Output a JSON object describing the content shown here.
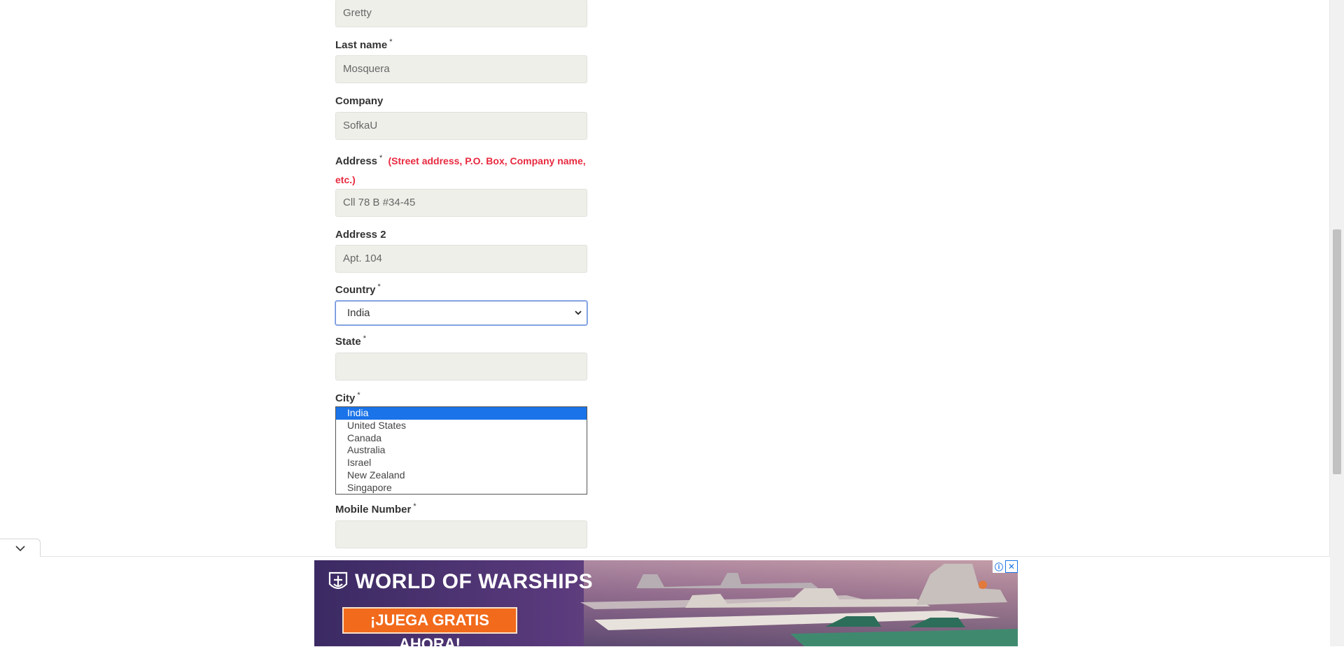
{
  "form": {
    "first_name": {
      "value": "Gretty"
    },
    "last_name": {
      "label": "Last name",
      "required_mark": "*",
      "value": "Mosquera"
    },
    "company": {
      "label": "Company",
      "value": "SofkaU"
    },
    "address": {
      "label": "Address",
      "required_mark": "*",
      "hint_line1": "(Street address, P.O. Box, Company name,",
      "hint_line2": "etc.)",
      "value": "Cll 78 B #34-45"
    },
    "address2": {
      "label": "Address 2",
      "value": "Apt. 104"
    },
    "country": {
      "label": "Country",
      "required_mark": "*",
      "selected": "India",
      "options": [
        "India",
        "United States",
        "Canada",
        "Australia",
        "Israel",
        "New Zealand",
        "Singapore"
      ]
    },
    "state": {
      "label": "State",
      "required_mark": "*",
      "value": ""
    },
    "city": {
      "label": "City",
      "required_mark": "*"
    },
    "mobile": {
      "label": "Mobile Number",
      "required_mark": "*",
      "value": ""
    }
  },
  "ad": {
    "brand": "WORLD OF WARSHIPS",
    "cta": "¡JUEGA GRATIS AHORA!",
    "info_icon": "info-icon",
    "close_icon": "close-icon"
  },
  "colors": {
    "hint_red": "#e8293f",
    "selected_option_bg": "#1a73e8",
    "cta_orange": "#f26a1b",
    "input_bg": "#efefea"
  }
}
